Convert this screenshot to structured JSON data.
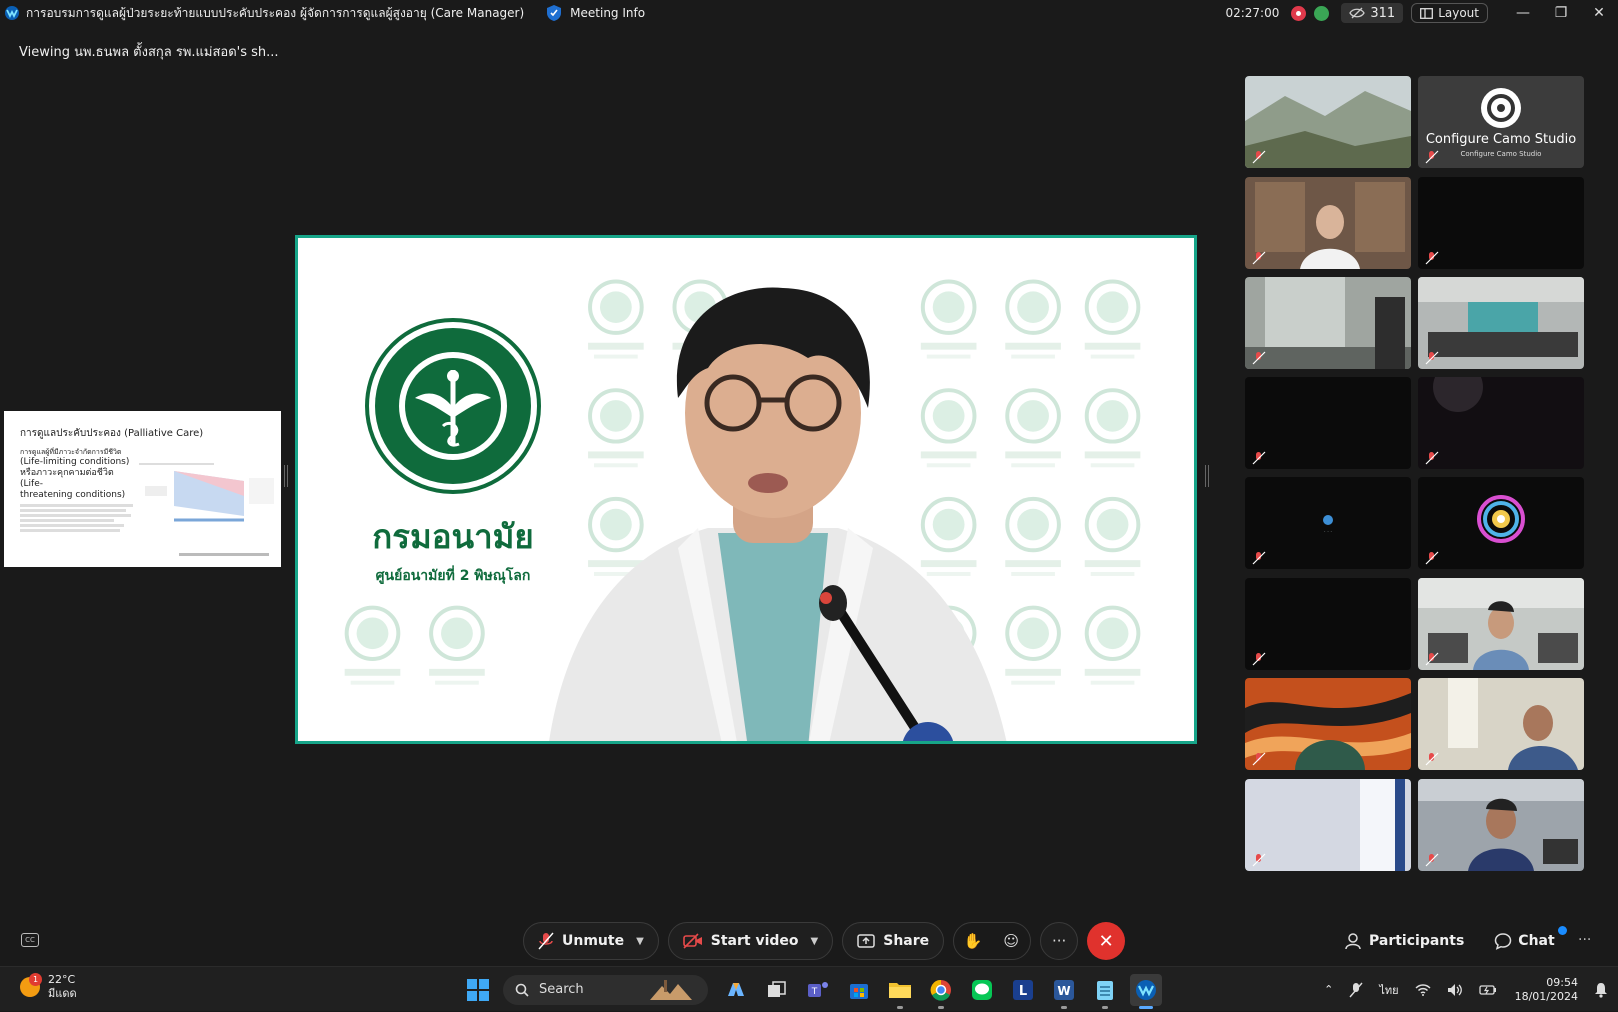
{
  "titlebar": {
    "title": "การอบรมการดูแลผู้ป่วยระยะท้ายแบบประคับประคอง ผู้จัดการการดูแลผู้สูงอายุ (Care Manager)",
    "meeting_info": "Meeting Info",
    "timer": "02:27:00",
    "participant_count": "311",
    "layout_label": "Layout"
  },
  "viewing_text": "Viewing นพ.ธนพล ตั้งสกุล รพ.แม่สอด's sh...",
  "share": {
    "ministry_name": "กรมอนามัย",
    "ministry_sub": "ศูนย์อนามัยที่ 2 พิษณุโลก"
  },
  "slide": {
    "title": "การดูแลประคับประคอง (Palliative Care)",
    "line1": "การดูแลผู้ที่มีภาวะจำกัดการมีชีวิต",
    "line2": "(Life-limiting conditions)",
    "line3": "หรือภาวะคุกคามต่อชีวิต (Life-",
    "line4": "threatening conditions)"
  },
  "gallery": {
    "camo_title": "Configure Camo Studio",
    "camo_sub": "Configure Camo Studio"
  },
  "controls": {
    "unmute": "Unmute",
    "start_video": "Start video",
    "share": "Share",
    "participants": "Participants",
    "chat": "Chat"
  },
  "taskbar": {
    "temperature": "22°C",
    "weather": "มีแดด",
    "weather_badge": "1",
    "search": "Search",
    "language": "ไทย",
    "time": "09:54",
    "date": "18/01/2024"
  }
}
